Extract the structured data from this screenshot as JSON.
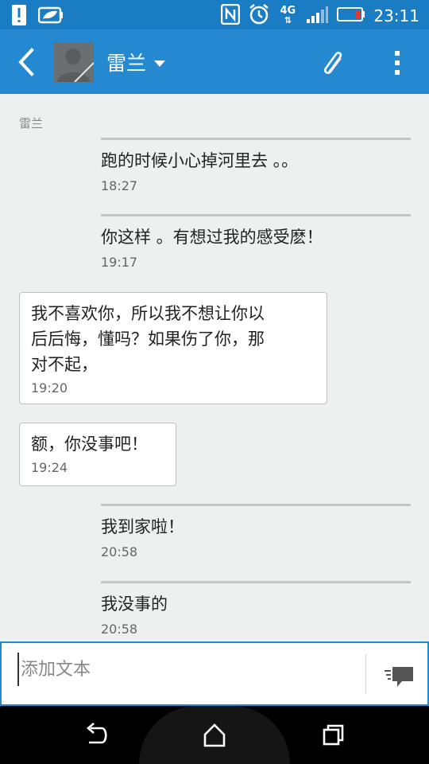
{
  "status_bar": {
    "time": "23:11",
    "network": "4G",
    "icons": [
      "alert-icon",
      "battery-saver-icon",
      "nfc-icon",
      "alarm-icon",
      "signal-icon",
      "battery-icon"
    ]
  },
  "header": {
    "contact_name": "雷兰",
    "icons": [
      "back-arrow-icon",
      "avatar-placeholder",
      "dropdown-caret-icon",
      "paperclip-icon",
      "more-vert-icon"
    ]
  },
  "thread": {
    "sender_label": "雷兰",
    "messages": [
      {
        "direction": "outgoing",
        "text": "跑的时候小心掉河里去 。。",
        "time": "18:27"
      },
      {
        "direction": "outgoing",
        "text": "你这样 。有想过我的感受麽！",
        "time": "19:17"
      },
      {
        "direction": "incoming",
        "lines": [
          "我不喜欢你，所以我不想让你以",
          "后后悔，懂吗？如果伤了你，那",
          "对不起，"
        ],
        "time": "19:20"
      },
      {
        "direction": "incoming",
        "lines": [
          "额，你没事吧！"
        ],
        "time": "19:24"
      },
      {
        "direction": "outgoing",
        "text": "我到家啦！",
        "time": "20:58"
      },
      {
        "direction": "outgoing",
        "text": "我没事的",
        "time": "20:58"
      }
    ]
  },
  "composer": {
    "placeholder": "添加文本",
    "value": ""
  },
  "nav": {
    "icons": [
      "back-nav-icon",
      "home-nav-icon",
      "recents-nav-icon"
    ]
  },
  "colors": {
    "status_bar": "#1a7dc4",
    "app_bar": "#2489d1",
    "background": "#eef0f0"
  }
}
